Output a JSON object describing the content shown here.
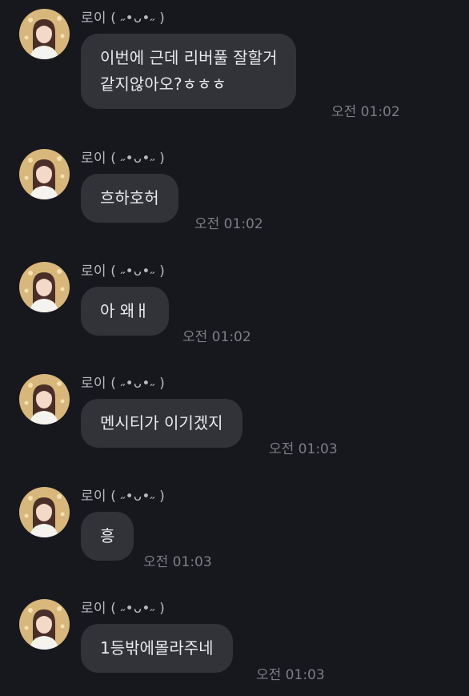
{
  "chat": {
    "messages": [
      {
        "sender": "로이 ( ˶•ᴗ•˶ )",
        "lines": [
          "이번에 근데 리버풀 잘할거",
          "같지않아오?ㅎㅎㅎ"
        ],
        "time": "오전 01:02"
      },
      {
        "sender": "로이 ( ˶•ᴗ•˶ )",
        "lines": [
          "흐하호허"
        ],
        "time": "오전 01:02"
      },
      {
        "sender": "로이 ( ˶•ᴗ•˶ )",
        "lines": [
          "아 왜ㅐ"
        ],
        "time": "오전 01:02"
      },
      {
        "sender": "로이 ( ˶•ᴗ•˶ )",
        "lines": [
          "멘시티가 이기겠지"
        ],
        "time": "오전 01:03"
      },
      {
        "sender": "로이 ( ˶•ᴗ•˶ )",
        "lines": [
          "흥"
        ],
        "time": "오전 01:03"
      },
      {
        "sender": "로이 ( ˶•ᴗ•˶ )",
        "lines": [
          "1등밖에몰라주네"
        ],
        "time": "오전 01:03"
      }
    ]
  },
  "colors": {
    "background": "#17181d",
    "bubble": "#323338",
    "sender_text": "#b9bac0",
    "message_text": "#e9e9ec",
    "time_text": "#7d7e85"
  }
}
